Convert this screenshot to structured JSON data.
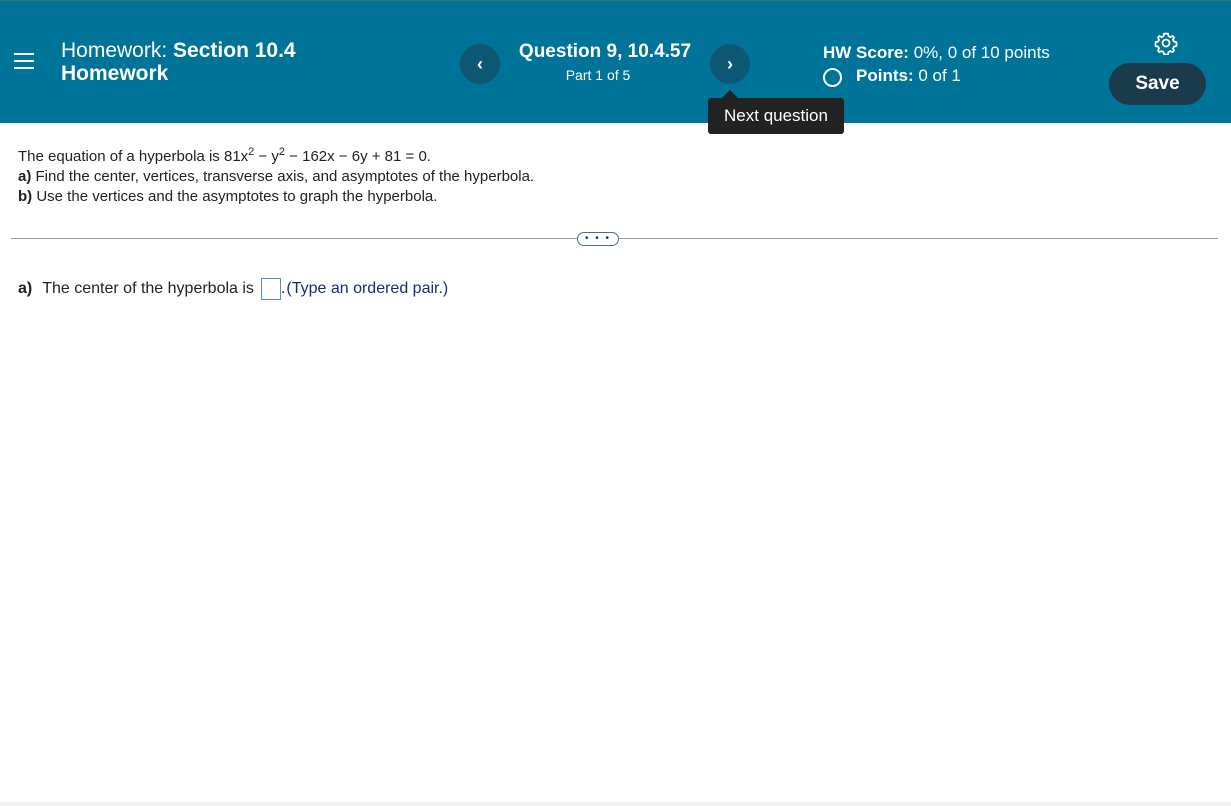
{
  "header": {
    "hw_prefix": "Homework:",
    "hw_section": "Section 10.4",
    "hw_line2": "Homework",
    "question_title": "Question 9, 10.4.57",
    "part": "Part 1 of 5",
    "prev_symbol": "‹",
    "next_symbol": "›",
    "tooltip": "Next question",
    "score_label": "HW Score:",
    "score_value": "0%, 0 of 10 points",
    "points_label": "Points:",
    "points_value": "0 of 1",
    "save_label": "Save",
    "icons": [
      "hamburger-menu-icon",
      "chevron-left-icon",
      "chevron-right-icon",
      "circle-icon",
      "gear-icon"
    ],
    "bar_color": "#007398"
  },
  "question": {
    "line1_prefix": "The equation of a hyperbola is 81x",
    "exp1": "2",
    "line1_mid": " − y",
    "exp2": "2",
    "line1_suffix": " − 162x − 6y + 81 = 0.",
    "a_label": "a)",
    "a_text": " Find the center, vertices, transverse axis, and asymptotes of the hyperbola.",
    "b_label": "b)",
    "b_text": " Use the vertices and the asymptotes to graph the hyperbola."
  },
  "more_label": "• • •",
  "answer": {
    "label": "a)",
    "text": "The center of the hyperbola is",
    "after": ".",
    "hint": " (Type an ordered pair.)",
    "value": ""
  }
}
